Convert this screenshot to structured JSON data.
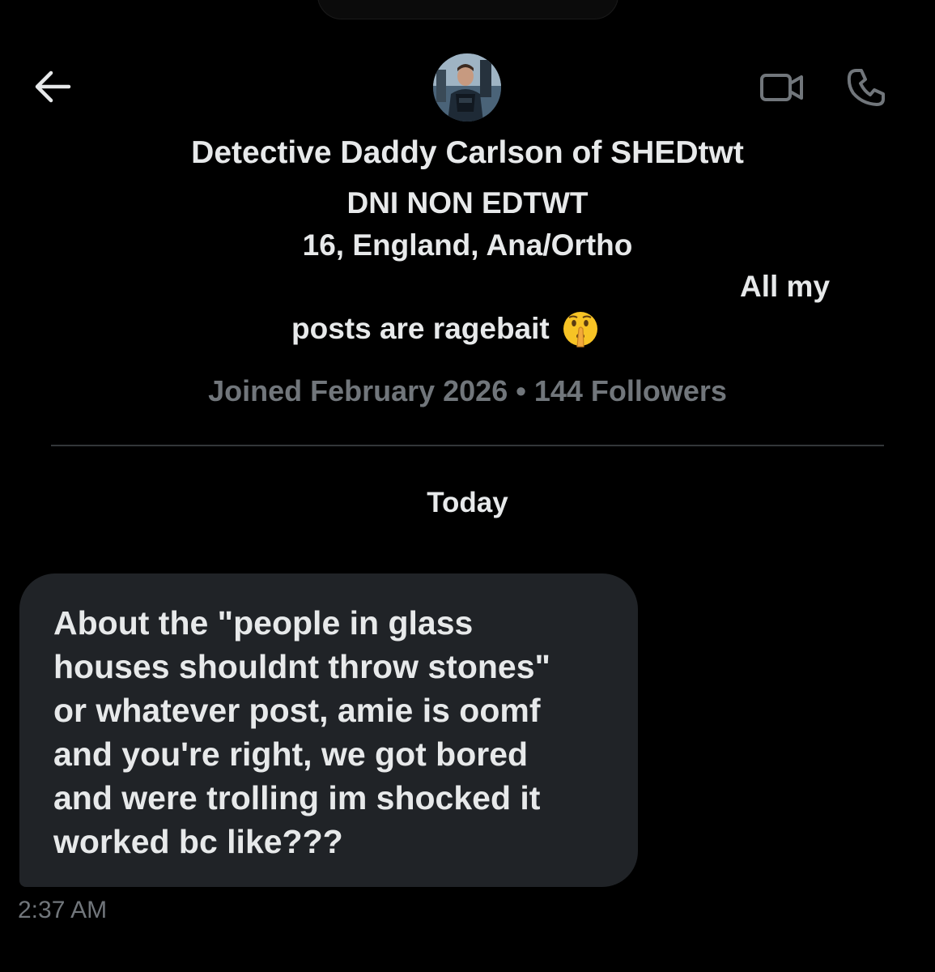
{
  "header": {
    "back_icon": "arrow-left-icon",
    "video_icon": "video-camera-icon",
    "call_icon": "phone-icon"
  },
  "profile": {
    "display_name": "Detective Daddy Carlson of SHEDtwt",
    "bio_line_1": "DNI NON EDTWT",
    "bio_line_2": "16, England, Ana/Ortho",
    "bio_line_3": "All my",
    "bio_line_4": "posts are ragebait",
    "bio_emoji": "shushing-face-icon",
    "meta": "Joined February 2026 • 144 Followers"
  },
  "conversation": {
    "date_label": "Today",
    "messages": [
      {
        "text": "About the \"people in glass houses shouldnt throw stones\" or whatever post, amie is oomf and you're right, we got bored and were trolling im shocked it worked bc like???",
        "display_lines": "About the \"people in glass\nhouses shouldnt throw stones\"\nor whatever post, amie is oomf\nand you're right, we got bored\nand were trolling im shocked it\nworked bc like???",
        "time": "2:37 AM"
      }
    ]
  },
  "colors": {
    "background": "#000000",
    "primary_text": "#e7e9ea",
    "secondary_text": "#71767b",
    "bubble": "#202327",
    "divider": "#333639"
  }
}
